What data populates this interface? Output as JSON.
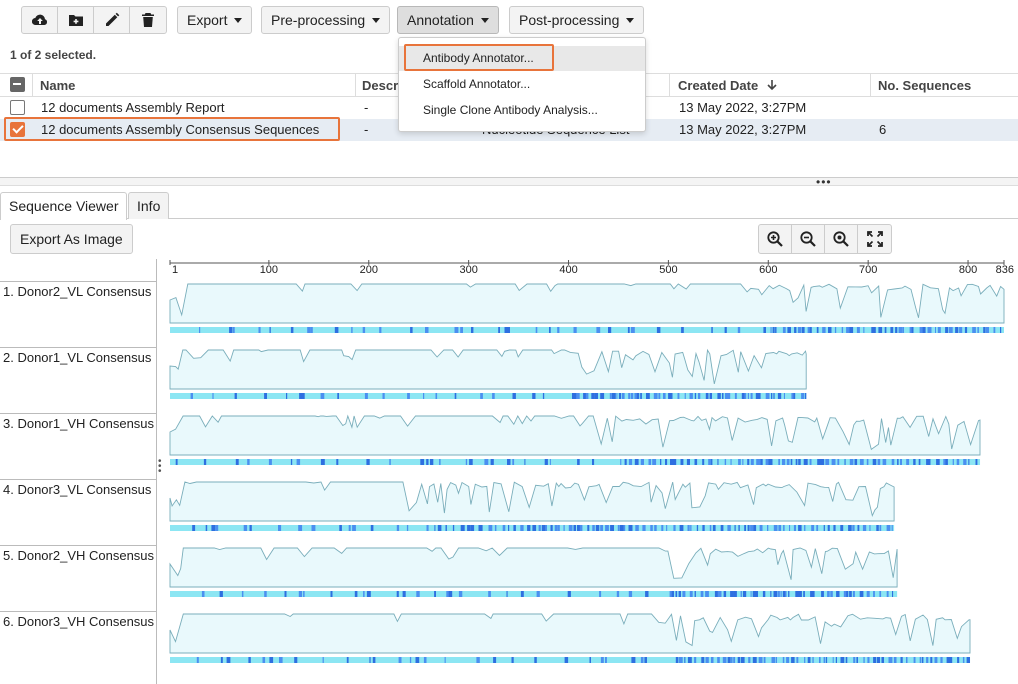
{
  "toolbar": {
    "icon_buttons": [
      "cloud-upload-icon",
      "folder-add-icon",
      "pencil-icon",
      "trash-icon"
    ],
    "menus": [
      {
        "label": "Export"
      },
      {
        "label": "Pre-processing"
      },
      {
        "label": "Annotation"
      },
      {
        "label": "Post-processing"
      }
    ]
  },
  "selection_info": "1 of 2 selected.",
  "table": {
    "columns": [
      "Name",
      "Descri",
      "Created Date",
      "No. Sequences"
    ],
    "rows": [
      {
        "name": "12 documents Assembly Report",
        "description": "-",
        "type": "",
        "created": "13 May 2022, 3:27PM",
        "sequences": "",
        "checked": false
      },
      {
        "name": "12 documents Assembly Consensus Sequences",
        "description": "-",
        "type": "Nucleotide Sequence List",
        "created": "13 May 2022, 3:27PM",
        "sequences": "6",
        "checked": true
      }
    ]
  },
  "annotation_menu": {
    "items": [
      "Antibody Annotator...",
      "Scaffold Annotator...",
      "Single Clone Antibody Analysis..."
    ]
  },
  "tabs": [
    "Sequence Viewer",
    "Info"
  ],
  "viewer": {
    "export_label": "Export As Image",
    "zoom_icons": [
      "zoom-in-icon",
      "zoom-out-icon",
      "zoom-fit-icon",
      "fullscreen-icon"
    ],
    "ruler": [
      "1",
      "100",
      "200",
      "300",
      "400",
      "500",
      "600",
      "700",
      "800",
      "836"
    ],
    "ruler_max": 836,
    "sequences": [
      {
        "name": "1. Donor2_VL Consensus",
        "length": 836,
        "flat_until": 580
      },
      {
        "name": "2. Donor1_VL Consensus",
        "length": 638,
        "flat_until": 400
      },
      {
        "name": "3. Donor1_VH Consensus",
        "length": 812,
        "flat_until": 425
      },
      {
        "name": "4. Donor3_VL Consensus",
        "length": 726,
        "flat_until": 240
      },
      {
        "name": "5. Donor2_VH Consensus",
        "length": 729,
        "flat_until": 493
      },
      {
        "name": "6. Donor3_VH Consensus",
        "length": 802,
        "flat_until": 490
      }
    ]
  },
  "colors": {
    "accent": "#e8743b",
    "coverage_fill": "#e9f9fc",
    "coverage_line": "#7aaebb",
    "track_base": "#8ce6f3",
    "track_dark": "#2e6fe0"
  }
}
